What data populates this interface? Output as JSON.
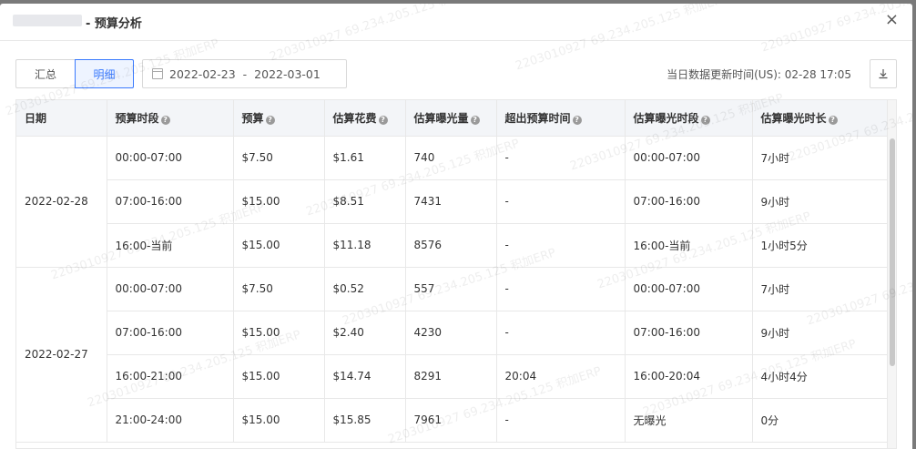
{
  "dialog": {
    "title": "- 预算分析",
    "close": "×"
  },
  "toolbar": {
    "tabs": [
      "汇总",
      "明细"
    ],
    "active_tab": "明细",
    "date_start": "2022-02-23",
    "date_sep": "-",
    "date_end": "2022-03-01",
    "update_time": "当日数据更新时间(US): 02-28 17:05"
  },
  "table": {
    "columns": [
      "日期",
      "预算时段",
      "预算",
      "估算花费",
      "估算曝光量",
      "超出预算时间",
      "估算曝光时段",
      "估算曝光时长"
    ],
    "groups": [
      {
        "date": "2022-02-28",
        "rows": [
          [
            "00:00-07:00",
            "$7.50",
            "$1.61",
            "740",
            "-",
            "00:00-07:00",
            "7小时"
          ],
          [
            "07:00-16:00",
            "$15.00",
            "$8.51",
            "7431",
            "-",
            "07:00-16:00",
            "9小时"
          ],
          [
            "16:00-当前",
            "$15.00",
            "$11.18",
            "8576",
            "-",
            "16:00-当前",
            "1小时5分"
          ]
        ]
      },
      {
        "date": "2022-02-27",
        "rows": [
          [
            "00:00-07:00",
            "$7.50",
            "$0.52",
            "557",
            "-",
            "00:00-07:00",
            "7小时"
          ],
          [
            "07:00-16:00",
            "$15.00",
            "$2.40",
            "4230",
            "-",
            "07:00-16:00",
            "9小时"
          ],
          [
            "16:00-21:00",
            "$15.00",
            "$14.74",
            "8291",
            "20:04",
            "16:00-20:04",
            "4小时4分"
          ],
          [
            "21:00-24:00",
            "$15.00",
            "$15.85",
            "7961",
            "-",
            "无曝光",
            "0分"
          ]
        ]
      }
    ]
  },
  "watermark": "2203010927 69.234.205.125 积加ERP",
  "colors": {
    "accent": "#3a7afe",
    "header_bg": "#f3f5f8"
  }
}
